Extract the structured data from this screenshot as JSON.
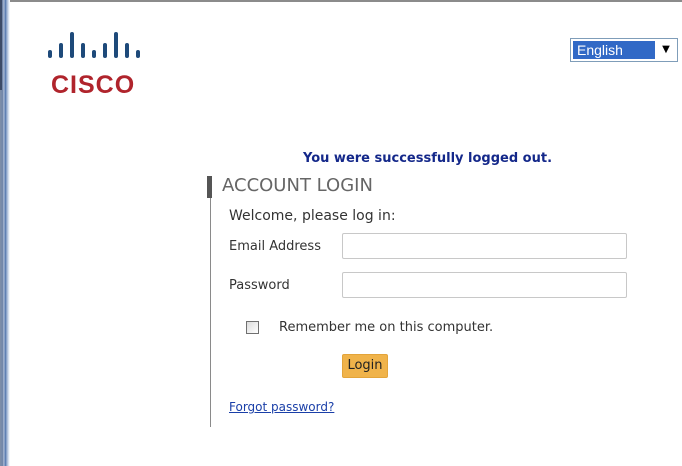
{
  "logo": {
    "wordmark": "CISCO",
    "icon": "cisco-bars-logo",
    "color": "#b0242c"
  },
  "language": {
    "selected": "English",
    "arrow_icon": "chevron-down-icon"
  },
  "messages": {
    "logout": "You were successfully logged out."
  },
  "account": {
    "title": "ACCOUNT LOGIN",
    "welcome": "Welcome, please log in:",
    "email_label": "Email Address",
    "email_value": "",
    "password_label": "Password",
    "password_value": "",
    "remember_label": "Remember me on this computer.",
    "remember_checked": false,
    "login_label": "Login",
    "forgot_label": "Forgot password?"
  },
  "colors": {
    "accent_button": "#f0b34a",
    "message_text": "#14288a",
    "link": "#1a3fa8",
    "select_highlight": "#3169c6"
  }
}
